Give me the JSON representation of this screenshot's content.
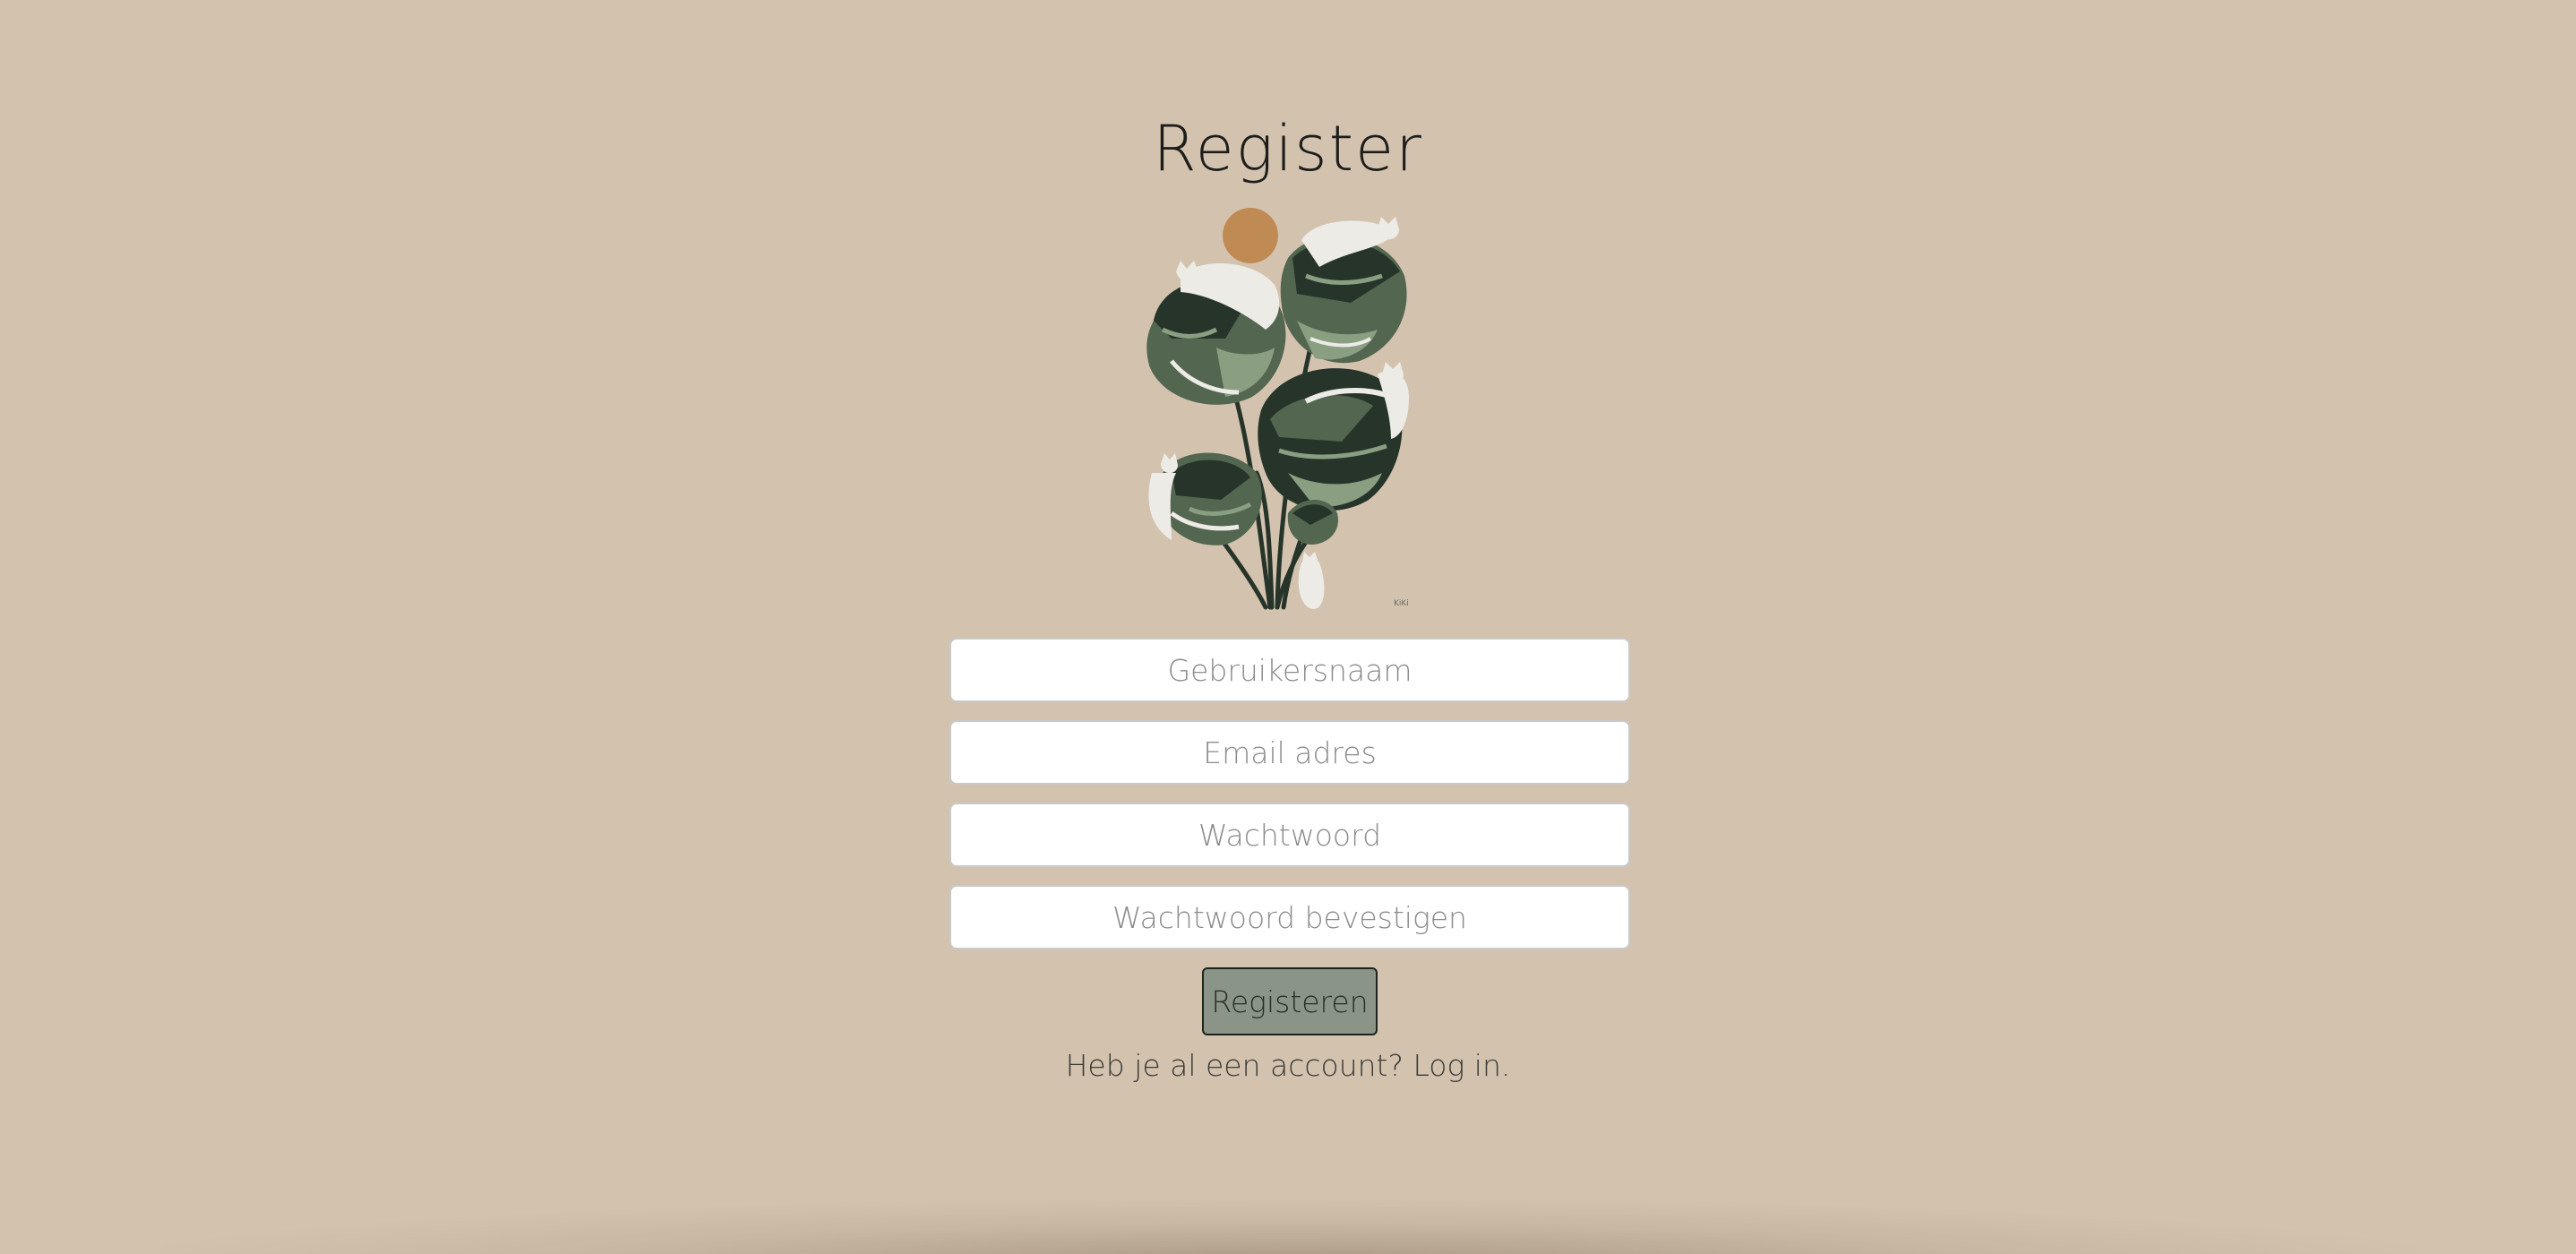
{
  "page": {
    "title": "Register",
    "background_color": "#d3c3ae"
  },
  "illustration": {
    "icon": "monstera-plant-with-cats-illustration",
    "signature": "KiKi",
    "colors": {
      "sun": "#c08a55",
      "leaf_dark": "#26342a",
      "leaf_mid": "#53664f",
      "leaf_light": "#8a9e82",
      "cat": "#ecebe6"
    }
  },
  "form": {
    "username_placeholder": "Gebruikersnaam",
    "email_placeholder": "Email adres",
    "password_placeholder": "Wachtwoord",
    "password_confirm_placeholder": "Wachtwoord bevestigen",
    "submit_label": "Registeren",
    "submit_color": "#8a9487"
  },
  "footer": {
    "question": "Heb je al een account?",
    "login_link": "Log in."
  }
}
